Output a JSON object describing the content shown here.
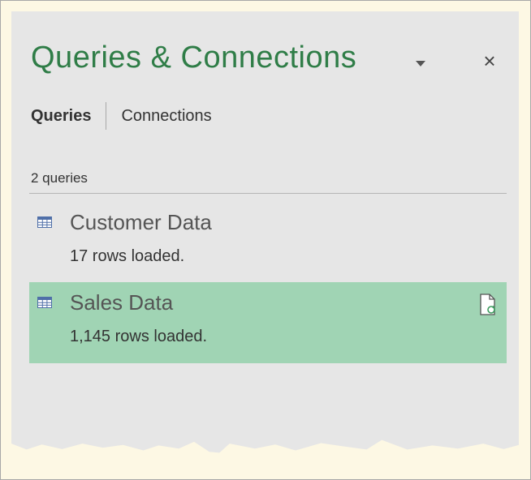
{
  "pane": {
    "title": "Queries & Connections",
    "dropdown_icon": "chevron-down-icon",
    "close_label": "×"
  },
  "tabs": [
    {
      "label": "Queries",
      "active": true
    },
    {
      "label": "Connections",
      "active": false
    }
  ],
  "query_count": "2 queries",
  "queries": [
    {
      "name": "Customer Data",
      "rows": "17 rows loaded.",
      "icon": "table-icon",
      "selected": false
    },
    {
      "name": "Sales Data",
      "rows": "1,145 rows loaded.",
      "icon": "table-icon",
      "selected": true,
      "status_icon": "refresh-document-icon"
    }
  ],
  "colors": {
    "title": "#2f7d47",
    "pane_background": "#e6e6e6",
    "selected_row": "#a0d4b4",
    "page_background": "#fdf8e4"
  }
}
